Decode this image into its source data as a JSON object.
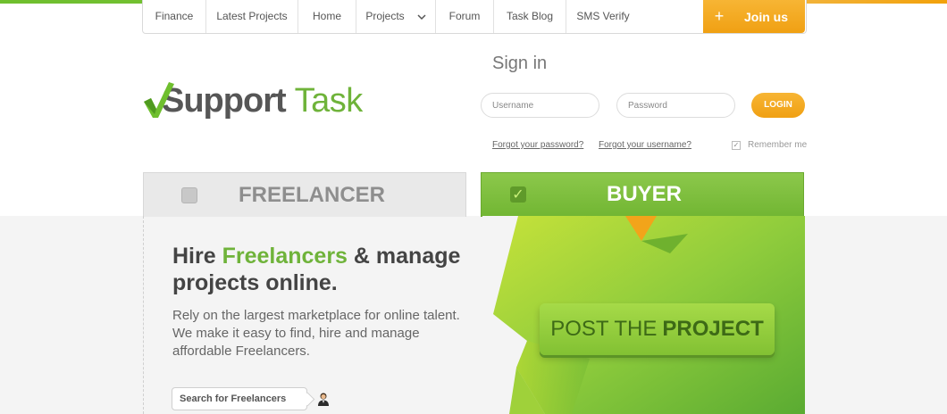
{
  "nav": {
    "items": [
      {
        "label": "Finance"
      },
      {
        "label": "Latest Projects"
      },
      {
        "label": "Home"
      },
      {
        "label": "Projects"
      },
      {
        "label": "Forum"
      },
      {
        "label": "Task Blog"
      },
      {
        "label": "SMS Verify"
      }
    ],
    "join": {
      "label": "Join us",
      "icon": "plus-icon"
    }
  },
  "logo": {
    "word1": "Support",
    "word2": "Task",
    "icon": "checkmark-logo-icon"
  },
  "signin": {
    "title": "Sign in",
    "username_placeholder": "Username",
    "password_placeholder": "Password",
    "login_label": "LOGIN",
    "forgot_password": "Forgot your password?",
    "forgot_username": "Forgot your username?",
    "remember_me": "Remember me"
  },
  "tabs": {
    "freelancer": "FREELANCER",
    "buyer": "BUYER"
  },
  "hero": {
    "headline_part1": "Hire ",
    "headline_accent": "Freelancers",
    "headline_part2": " & manage projects online.",
    "description": "Rely on the largest marketplace for online talent. We make it easy to find, hire and manage affordable Freelancers.",
    "search_label": "Search for Freelancers",
    "post_label_1": "POST THE",
    "post_label_2": "PROJECT"
  },
  "colors": {
    "brand_green": "#6fb33a",
    "accent_orange": "#f0a013"
  }
}
